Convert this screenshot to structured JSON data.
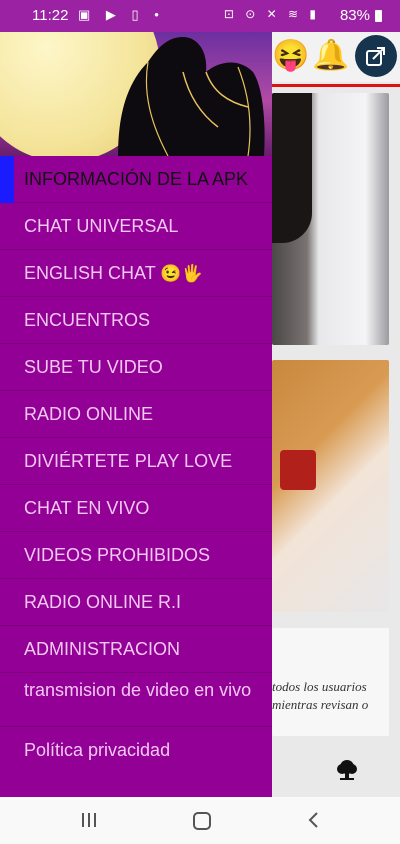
{
  "status_bar": {
    "time": "11:22",
    "left_icons": "▣ ▶ ▯ •",
    "right_icons": "⊡ ⊙ ✕ ≋ ▮",
    "battery": "83%"
  },
  "drawer": {
    "active_indicator_color": "#1b1bff",
    "background_color": "#930096",
    "items": [
      {
        "label": "INFORMACIÓN DE LA APK"
      },
      {
        "label": "CHAT UNIVERSAL"
      },
      {
        "label": " ENGLISH CHAT",
        "emoji": "😉🖐"
      },
      {
        "label": "ENCUENTROS"
      },
      {
        "label": "SUBE TU VIDEO"
      },
      {
        "label": "RADIO ONLINE"
      },
      {
        "label": "DIVIÉRTETE  PLAY LOVE"
      },
      {
        "label": "CHAT EN VIVO"
      },
      {
        "label": "VIDEOS PROHIBIDOS"
      },
      {
        "label": "RADIO ONLINE  R.I"
      },
      {
        "label": "ADMINISTRACION"
      },
      {
        "label": "transmision de video en vivo"
      },
      {
        "label": "Política privacidad"
      }
    ]
  },
  "background": {
    "top_emojis": [
      "😝",
      "🔔"
    ],
    "card3_line1": "todos los usuarios",
    "card3_line2": "mientras revisan o",
    "icons": [
      "share-icon",
      "tree-icon"
    ]
  }
}
